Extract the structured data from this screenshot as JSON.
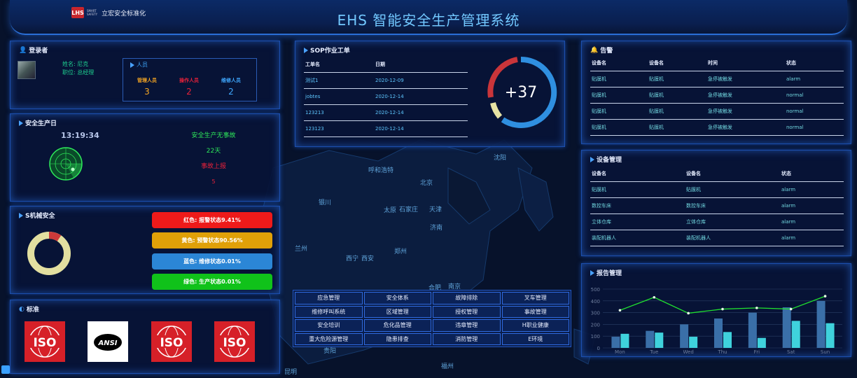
{
  "header": {
    "title": "EHS 智能安全生产管理系统",
    "logo_text": "立宏安全标准化",
    "logo_mark": "LHS",
    "logo_sub_lines": [
      "SMART",
      "SAFETY"
    ]
  },
  "map_cities": [
    "沈阳",
    "呼和浩特",
    "北京",
    "天津",
    "银川",
    "太原",
    "石家庄",
    "济南",
    "兰州",
    "西宁",
    "郑州",
    "西安",
    "合肥",
    "南京",
    "贵阳",
    "昆明",
    "福州"
  ],
  "login": {
    "title": "登录者",
    "name": "姓名: 尼克",
    "position": "职位: 总经理",
    "staff_title": "人员",
    "staff": [
      {
        "label": "管理人员",
        "value": "3",
        "color": "#f5a623"
      },
      {
        "label": "操作人员",
        "value": "2",
        "color": "#e8213a"
      },
      {
        "label": "维修人员",
        "value": "2",
        "color": "#3fa8ff"
      }
    ]
  },
  "safety_day": {
    "title": "安全生产日",
    "clock": "13:19:34",
    "no_accident_label": "安全生产无事故",
    "days": "22天",
    "report_label": "事故上报",
    "report_count": "5"
  },
  "machine": {
    "title": "S机械安全",
    "donut": {
      "total": 100,
      "red_pct": 9.41,
      "ring_color": "#e2dfa0",
      "red_color": "#cc3a3a"
    },
    "bars": [
      {
        "label": "红色: 报警状态9.41%",
        "color": "#ee1a1a"
      },
      {
        "label": "黄色: 预警状态90.56%",
        "color": "#e0a008"
      },
      {
        "label": "蓝色: 维修状态0.01%",
        "color": "#2b86d6"
      },
      {
        "label": "绿色: 生产状态0.01%",
        "color": "#10c21a"
      }
    ]
  },
  "standards": {
    "title": "标准",
    "logos": [
      "ISO",
      "ANSI",
      "ISO",
      "ISO"
    ]
  },
  "sop": {
    "title": "SOP作业工单",
    "columns": [
      "工单名",
      "日期"
    ],
    "rows": [
      [
        "测试1",
        "2020-12-09"
      ],
      [
        "jobtes",
        "2020-12-14"
      ],
      [
        "123213",
        "2020-12-14"
      ],
      [
        "123123",
        "2020-12-14"
      ]
    ],
    "gauge_text": "+37",
    "gauge": {
      "blue_color": "#2f8fe0",
      "red_color": "#c9353a",
      "yellow_color": "#e7e3a4"
    }
  },
  "alarm": {
    "title": "告警",
    "columns": [
      "设备名",
      "设备名",
      "时间",
      "状态"
    ],
    "rows": [
      [
        "贴膜机",
        "贴膜机",
        "急停被触发",
        "alarm"
      ],
      [
        "贴膜机",
        "贴膜机",
        "急停被触发",
        "normal"
      ],
      [
        "贴膜机",
        "贴膜机",
        "急停被触发",
        "normal"
      ],
      [
        "贴膜机",
        "贴膜机",
        "急停被触发",
        "normal"
      ]
    ]
  },
  "devices": {
    "title": "设备管理",
    "columns": [
      "设备名",
      "设备名",
      "状态"
    ],
    "rows": [
      [
        "贴膜机",
        "贴膜机",
        "alarm"
      ],
      [
        "数控车床",
        "数控车床",
        "alarm"
      ],
      [
        "立体仓库",
        "立体仓库",
        "alarm"
      ],
      [
        "装配机器人",
        "装配机器人",
        "alarm"
      ]
    ]
  },
  "quick_menu": [
    "应急管理",
    "安全体系",
    "故障排除",
    "叉车管理",
    "维修呼叫系统",
    "区域管理",
    "授权管理",
    "事故管理",
    "安全培训",
    "危化品管理",
    "违章管理",
    "H职业健康",
    "重大危险源管理",
    "隐患排查",
    "消防管理",
    "E环境"
  ],
  "report": {
    "title": "报告管理"
  },
  "chart_data": {
    "type": "bar",
    "categories": [
      "Mon",
      "Tue",
      "Wed",
      "Thu",
      "Fri",
      "Sat",
      "Sun"
    ],
    "ylim": [
      0,
      500
    ],
    "yticks": [
      0,
      100,
      200,
      300,
      400,
      500
    ],
    "series": [
      {
        "type": "bar",
        "values": [
          95,
          145,
          200,
          250,
          300,
          345,
          400
        ],
        "color": "#3a6fa8"
      },
      {
        "type": "bar",
        "values": [
          120,
          130,
          95,
          135,
          85,
          230,
          210
        ],
        "color": "#3fd2dc"
      },
      {
        "type": "line",
        "values": [
          320,
          430,
          295,
          330,
          340,
          330,
          440
        ],
        "color": "#20e030"
      }
    ]
  }
}
